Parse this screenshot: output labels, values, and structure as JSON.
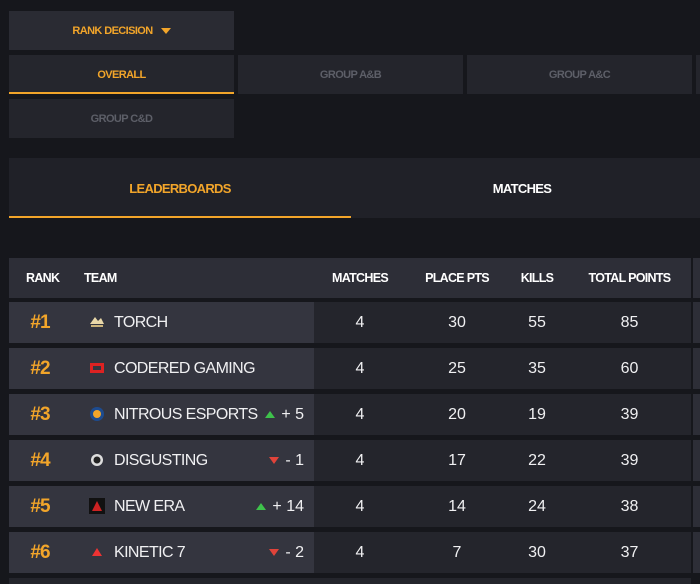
{
  "colors": {
    "accent": "#f2a52a",
    "up": "#3ec24b",
    "down": "#e0433a"
  },
  "rank_dropdown": {
    "label": "RANK DECISION",
    "icon": "caret-down-icon"
  },
  "groups": [
    "OVERALL",
    "GROUP A&B",
    "GROUP A&C",
    "GROUP C&D"
  ],
  "tabs": {
    "leaderboards": "LEADERBOARDS",
    "matches": "MATCHES"
  },
  "table": {
    "headers": {
      "rank": "RANK",
      "team": "TEAM",
      "matches": "MATCHES",
      "place_pts": "PLACE PTS",
      "kills": "KILLS",
      "total": "TOTAL POINTS"
    },
    "rows": [
      {
        "rank": "#1",
        "team": "TORCH",
        "logo": "torch-logo-icon",
        "delta": "",
        "dir": "",
        "matches": "4",
        "place_pts": "30",
        "kills": "55",
        "total": "85"
      },
      {
        "rank": "#2",
        "team": "CODERED GAMING",
        "logo": "codered-logo-icon",
        "delta": "",
        "dir": "",
        "matches": "4",
        "place_pts": "25",
        "kills": "35",
        "total": "60"
      },
      {
        "rank": "#3",
        "team": "NITROUS ESPORTS",
        "logo": "nitrous-logo-icon",
        "delta": "+ 5",
        "dir": "up",
        "matches": "4",
        "place_pts": "20",
        "kills": "19",
        "total": "39"
      },
      {
        "rank": "#4",
        "team": "DISGUSTING",
        "logo": "disgusting-logo-icon",
        "delta": "- 1",
        "dir": "down",
        "matches": "4",
        "place_pts": "17",
        "kills": "22",
        "total": "39"
      },
      {
        "rank": "#5",
        "team": "NEW ERA",
        "logo": "new-era-logo-icon",
        "delta": "+ 14",
        "dir": "up",
        "matches": "4",
        "place_pts": "14",
        "kills": "24",
        "total": "38"
      },
      {
        "rank": "#6",
        "team": "KINETIC 7",
        "logo": "kinetic-logo-icon",
        "delta": "- 2",
        "dir": "down",
        "matches": "4",
        "place_pts": "7",
        "kills": "30",
        "total": "37"
      }
    ]
  }
}
